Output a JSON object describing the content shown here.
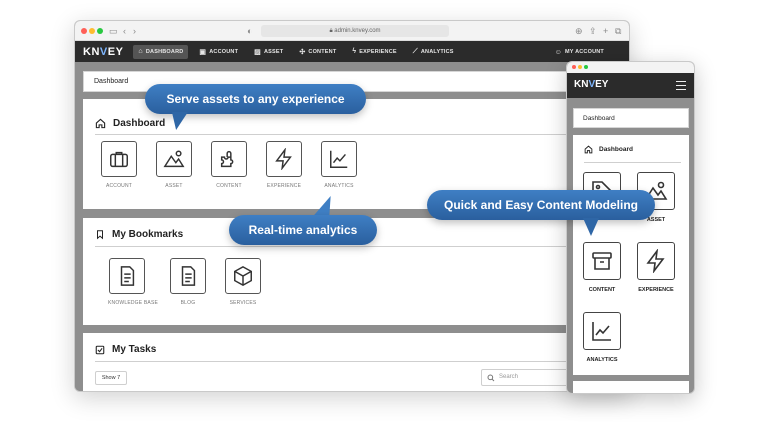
{
  "browser": {
    "url": "admin.knvey.com"
  },
  "nav": {
    "logo": {
      "main": "KN",
      "accent": "V",
      "tail": "EY"
    },
    "items": [
      {
        "label": "DASHBOARD",
        "icon": "home-icon",
        "active": true
      },
      {
        "label": "ACCOUNT",
        "icon": "briefcase-icon",
        "active": false
      },
      {
        "label": "ASSET",
        "icon": "image-icon",
        "active": false
      },
      {
        "label": "CONTENT",
        "icon": "puzzle-icon",
        "active": false
      },
      {
        "label": "EXPERIENCE",
        "icon": "lightning-icon",
        "active": false
      },
      {
        "label": "ANALYTICS",
        "icon": "chart-icon",
        "active": false
      }
    ],
    "my_account": "MY ACCOUNT"
  },
  "breadcrumb": "Dashboard",
  "dashboard_panel": {
    "title": "Dashboard",
    "tiles": [
      {
        "label": "ACCOUNT",
        "icon": "briefcase-icon"
      },
      {
        "label": "ASSET",
        "icon": "image-icon"
      },
      {
        "label": "CONTENT",
        "icon": "puzzle-icon"
      },
      {
        "label": "EXPERIENCE",
        "icon": "lightning-icon"
      },
      {
        "label": "ANALYTICS",
        "icon": "chart-icon"
      }
    ]
  },
  "bookmarks_panel": {
    "title": "My Bookmarks",
    "tiles": [
      {
        "label": "KNOWLEDGE BASE",
        "icon": "document-icon"
      },
      {
        "label": "BLOG",
        "icon": "document-icon"
      },
      {
        "label": "SERVICES",
        "icon": "cube-icon"
      }
    ]
  },
  "tasks_panel": {
    "title": "My Tasks",
    "show_label": "Show 7",
    "search_placeholder": "Search"
  },
  "mobile": {
    "breadcrumb": "Dashboard",
    "panel_title": "Dashboard",
    "tiles": [
      {
        "label": "",
        "icon": "tag-icon"
      },
      {
        "label": "ASSET",
        "icon": "image-icon"
      },
      {
        "label": "CONTENT",
        "icon": "archive-icon"
      },
      {
        "label": "EXPERIENCE",
        "icon": "lightning-icon"
      },
      {
        "label": "ANALYTICS",
        "icon": "chart-icon"
      }
    ]
  },
  "callouts": {
    "assets": "Serve assets to any experience",
    "analytics": "Real-time analytics",
    "modeling": "Quick and Easy Content Modeling"
  },
  "colors": {
    "navbar": "#2b2b2b",
    "callout": "#3f7fc4",
    "canvas": "#8e8e8e"
  }
}
